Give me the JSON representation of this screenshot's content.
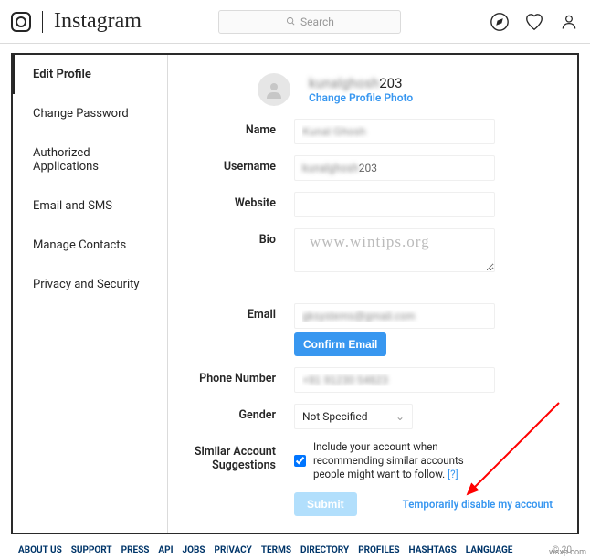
{
  "header": {
    "brand": "Instagram",
    "search_placeholder": "Search"
  },
  "sidebar": {
    "items": [
      {
        "label": "Edit Profile",
        "active": true
      },
      {
        "label": "Change Password"
      },
      {
        "label": "Authorized Applications"
      },
      {
        "label": "Email and SMS"
      },
      {
        "label": "Manage Contacts"
      },
      {
        "label": "Privacy and Security"
      }
    ]
  },
  "profile": {
    "username_display": "kunalghosh203",
    "change_photo": "Change Profile Photo",
    "labels": {
      "name": "Name",
      "username": "Username",
      "website": "Website",
      "bio": "Bio",
      "email": "Email",
      "phone": "Phone Number",
      "gender": "Gender",
      "similar": "Similar Account Suggestions"
    },
    "values": {
      "name": "Kunal Ghosh",
      "username": "kunalghosh203",
      "website": "",
      "bio": "",
      "email": "gksystems@gmail.com",
      "phone": "+91 91230 54623",
      "gender": "Not Specified"
    },
    "confirm_email": "Confirm Email",
    "similar_text": "Include your account when recommending similar accounts people might want to follow.",
    "similar_help": "[?]",
    "submit": "Submit",
    "disable": "Temporarily disable my account"
  },
  "watermark": "www.wintips.org",
  "footer": {
    "links": [
      "ABOUT US",
      "SUPPORT",
      "PRESS",
      "API",
      "JOBS",
      "PRIVACY",
      "TERMS",
      "DIRECTORY",
      "PROFILES",
      "HASHTAGS",
      "LANGUAGE"
    ],
    "copy": "© 20"
  },
  "corner": "wsxp.com"
}
